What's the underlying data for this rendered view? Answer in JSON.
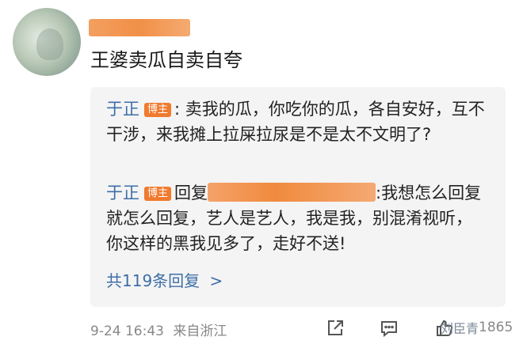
{
  "comment": {
    "username": "",
    "text": "王婆卖瓜自卖自夸"
  },
  "replies": [
    {
      "author": "于正",
      "badge": "博主",
      "text": ": 卖我的瓜，你吃你的瓜，各自安好，互不干涉，来我摊上拉屎拉尿是不是太不文明了?"
    },
    {
      "author": "于正",
      "badge": "博主",
      "reply_prefix": "回复",
      "text": ":我想怎么回复就怎么回复，艺人是艺人，我是我，别混淆视听，你这样的黑我见多了，走好不送!"
    }
  ],
  "more_replies_label": "共119条回复",
  "more_chevron": ">",
  "meta": {
    "time": "9-24 16:43",
    "location": "来自浙江"
  },
  "like_count": "1865",
  "watermark": "刘臣青",
  "icons": {
    "share": "share-icon",
    "comment": "comment-icon",
    "like": "like-icon"
  },
  "colors": {
    "link_blue": "#3d6ea8",
    "badge_orange": "#f07a2e",
    "reply_bg": "#f4f4f4"
  }
}
